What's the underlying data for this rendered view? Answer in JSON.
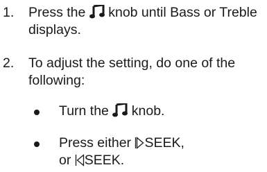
{
  "steps": [
    {
      "number": "1.",
      "text_before": "Press the",
      "icon": "music-note-icon",
      "text_after": "knob until Bass or Treble displays."
    },
    {
      "number": "2.",
      "text": "To adjust the setting, do one of the following:",
      "bullets": [
        {
          "text_before": "Turn the",
          "icon": "music-note-icon",
          "text_after": "knob."
        },
        {
          "text_before": "Press either",
          "icon_1": "seek-forward-icon",
          "label_1": "SEEK,",
          "text_middle": "or",
          "icon_2": "seek-back-icon",
          "label_2": "SEEK."
        }
      ]
    }
  ]
}
